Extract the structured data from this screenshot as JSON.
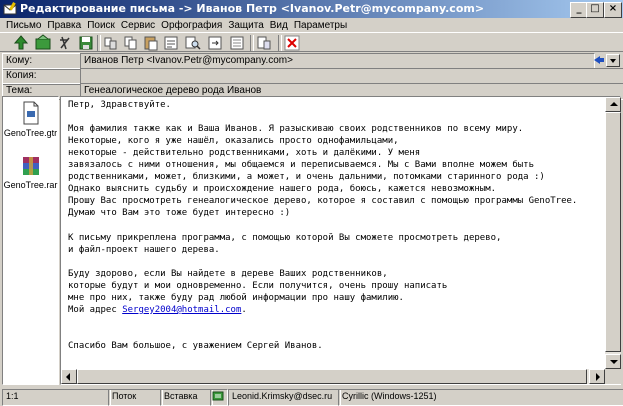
{
  "window": {
    "title": "Редактирование письма -> Иванов Петр <Ivanov.Petr@mycompany.com>",
    "minimize": "_",
    "maximize": "□",
    "close": "×"
  },
  "menu": [
    "Письмо",
    "Правка",
    "Поиск",
    "Сервис",
    "Орфография",
    "Защита",
    "Вид",
    "Параметры"
  ],
  "toolbar": {
    "icons": [
      "send-icon",
      "send-later-icon",
      "attach-icon",
      "save-icon",
      "cut-icon",
      "copy-icon",
      "paste-icon",
      "quote-icon",
      "find-icon",
      "find-next-icon",
      "replace-icon",
      "template-icon",
      "delete-icon"
    ]
  },
  "fields": {
    "to_label": "Кому:",
    "to_value": "Иванов Петр <Ivanov.Petr@mycompany.com>",
    "cc_label": "Копия:",
    "cc_value": "",
    "subject_label": "Тема:",
    "subject_value": "Генеалогическое дерево рода Иванов"
  },
  "attachments": [
    {
      "name": "GenoTree.gtr",
      "icon": "document-icon"
    },
    {
      "name": "GenoTree.rar",
      "icon": "rar-archive-icon"
    }
  ],
  "body": {
    "lines_before_link": [
      "Петр, Здравствуйте.",
      "",
      "Моя фамилия также как и Ваша Иванов. Я разыскиваю своих родственников по всему миру.",
      "Некоторые, кого я уже нашёл, оказались просто однофамильцами,",
      "некоторые - действительно родственниками, хоть и далёкими. У меня",
      "завязалось с ними отношения, мы общаемся и переписываемся. Мы с Вами вполне можем быть",
      "родственниками, может, близкими, а может, и очень дальними, потомками старинного рода :)",
      "Однако выяснить судьбу и происхождение нашего рода, боюсь, кажется невозможным.",
      "Прошу Вас просмотреть генеалогическое дерево, которое я составил с помощью программы GenoTree.",
      "Думаю что Вам это тоже будет интересно :)",
      "",
      "К письму прикреплена программа, с помощью которой Вы сможете просмотреть дерево,",
      "и файл-проект нашего дерева.",
      "",
      "Буду здорово, если Вы найдете в дереве Ваших родственников,",
      "которые будут и мои одновременно. Если получится, очень прошу написать",
      "мне про них, также буду рад любой информации про нашу фамилию."
    ],
    "address_prefix": "Мой адрес ",
    "address_link": "Sergey2004@hotmail.com",
    "address_suffix": ".",
    "closing": "Спасибо Вам большое, с уважением Сергей Иванов."
  },
  "status": {
    "position": "1:1",
    "mode1": "Поток",
    "mode2": "Вставка",
    "account": "Leonid.Krimsky@dsec.ru",
    "encoding": "Cyrillic (Windows-1251)"
  },
  "colors": {
    "titlebar_start": "#0a246a",
    "titlebar_end": "#a6caf0",
    "link": "#0000cc",
    "face": "#d4d0c8"
  }
}
